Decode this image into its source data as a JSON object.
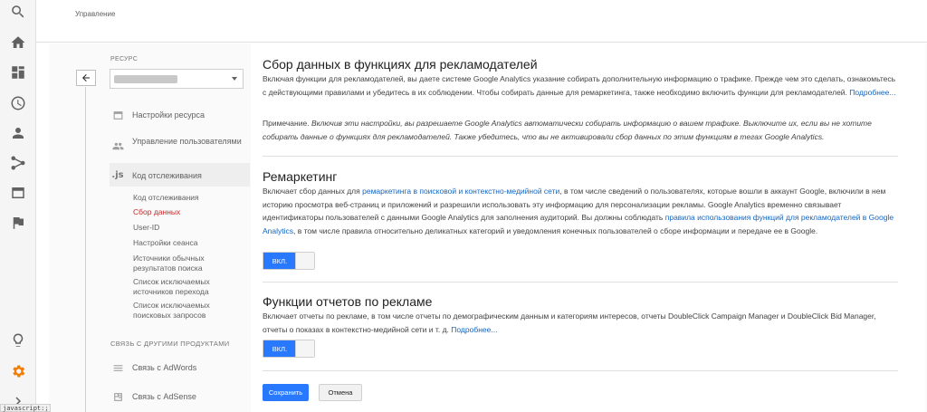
{
  "header": {
    "breadcrumb": "Управление"
  },
  "rail": {
    "icons": [
      "search-icon",
      "home-icon",
      "dashboard-icon",
      "clock-icon",
      "person-icon",
      "share-icon",
      "window-icon",
      "flag-icon",
      "lightbulb-icon",
      "gear-icon",
      "expand-icon"
    ],
    "accent_color": "#f57c00"
  },
  "sidebar": {
    "resource_label": "РЕСУРС",
    "items": [
      {
        "label": "Настройки ресурса",
        "icon": "window-icon"
      },
      {
        "label": "Управление пользователями",
        "icon": "people-icon"
      },
      {
        "label": "Код отслеживания",
        "icon": "js-icon",
        "icon_text": ".js"
      }
    ],
    "sub_items": [
      {
        "label": "Код отслеживания"
      },
      {
        "label": "Сбор данных"
      },
      {
        "label": "User-ID"
      },
      {
        "label": "Настройки сеанса"
      },
      {
        "label": "Источники обычных результатов поиска"
      },
      {
        "label": "Список исключаемых источников перехода"
      },
      {
        "label": "Список исключаемых поисковых запросов"
      }
    ],
    "active_sub_item": "Сбор данных",
    "section_label": "СВЯЗЬ С ДРУГИМИ ПРОДУКТАМИ",
    "product_links": [
      {
        "label": "Связь с AdWords",
        "icon": "adwords-icon"
      },
      {
        "label": "Связь с AdSense",
        "icon": "adsense-icon"
      }
    ]
  },
  "main": {
    "section1": {
      "title": "Сбор данных в функциях для рекламодателей",
      "desc_text": "Включая функции для рекламодателей, вы даете системе Google Analytics указание собирать дополнительную информацию о трафике. Прежде чем это сделать, ознакомьтесь с действующими правилами и убедитесь в их соблюдении. Чтобы собирать данные для ремаркетинга, также необходимо включить функции для рекламодателей.",
      "desc_link": "Подробнее...",
      "note_prefix": "Примечание.",
      "note_text": "Включив эти настройки, вы разрешаете Google Analytics автоматически собирать информацию о вашем трафике. Выключите их, если вы не хотите собирать данные о функциях для рекламодателей. Также убедитесь, что вы не активировали сбор данных по этим функциям в тегах Google Analytics."
    },
    "section2": {
      "title": "Ремаркетинг",
      "text1": "Включает сбор данных для",
      "link1": "ремаркетинга в поисковой и контекстно-медийной сети",
      "text2": ", в том числе сведений о пользователях, которые вошли в аккаунт Google, включили в нем историю просмотра веб-страниц и приложений и разрешили использовать эту информацию для персонализации рекламы. Google Analytics временно связывает идентификаторы пользователей с данными Google Analytics для заполнения аудиторий. Вы должны соблюдать",
      "link2": "правила использования функций для рекламодателей в Google Analytics",
      "text3": ", в том числе правила относительно деликатных категорий и уведомления конечных пользователей о сборе информации и передаче ее в Google.",
      "toggle_label": "ВКЛ."
    },
    "section3": {
      "title": "Функции отчетов по рекламе",
      "text": "Включает отчеты по рекламе, в том числе отчеты по демографическим данным и категориям интересов, отчеты DoubleClick Campaign Manager и DoubleClick Bid Manager, отчеты о показах в контекстно-медийной сети и т. д.",
      "link": "Подробнее...",
      "toggle_label": "ВКЛ."
    },
    "save_label": "Сохранить",
    "cancel_label": "Отмена"
  },
  "statusbar": {
    "text": "javascript:;"
  },
  "colors": {
    "primary": "#2979ff",
    "active_nav": "#c62828",
    "link": "#1565c0"
  }
}
